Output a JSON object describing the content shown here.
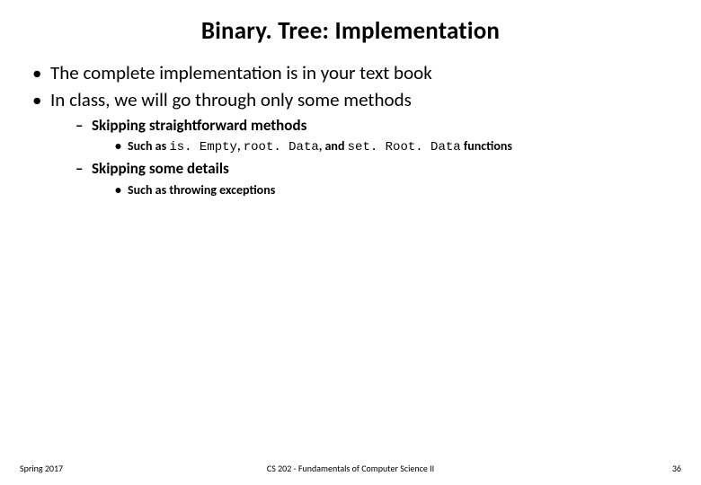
{
  "title": "Binary. Tree: Implementation",
  "bullets": {
    "b1": "The complete implementation is in your text book",
    "b2": "In class, we will go through only some methods",
    "b2_1": "Skipping straightforward methods",
    "b2_1_1_pre": "Such as ",
    "b2_1_1_code1": "is. Empty",
    "b2_1_1_mid1": ", ",
    "b2_1_1_code2": "root. Data",
    "b2_1_1_mid2": ", and ",
    "b2_1_1_code3": "set. Root. Data",
    "b2_1_1_post": " functions",
    "b2_2": "Skipping some details",
    "b2_2_1": "Such as throwing exceptions"
  },
  "footer": {
    "left": "Spring 2017",
    "center": "CS 202 - Fundamentals of Computer Science II",
    "right": "36"
  }
}
